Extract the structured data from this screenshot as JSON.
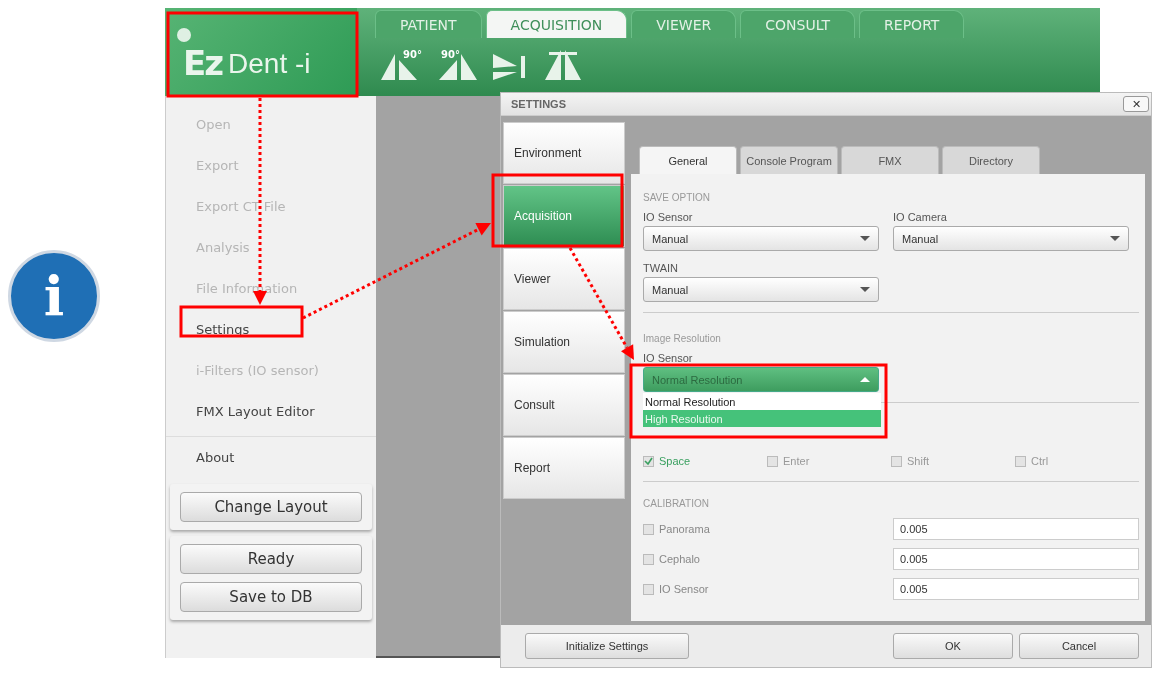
{
  "logo": {
    "mark": "Ez",
    "name": "Dent -i"
  },
  "main_tabs": [
    {
      "label": "PATIENT",
      "selected": false
    },
    {
      "label": "ACQUISITION",
      "selected": true
    },
    {
      "label": "VIEWER",
      "selected": false
    },
    {
      "label": "CONSULT",
      "selected": false
    },
    {
      "label": "REPORT",
      "selected": false
    }
  ],
  "toolbar": [
    {
      "kind": "left-angle",
      "label": "90°"
    },
    {
      "kind": "right-angle",
      "label": "90°"
    },
    {
      "kind": "flip"
    },
    {
      "kind": "split"
    }
  ],
  "menu": [
    {
      "label": "Open",
      "disabled": true
    },
    {
      "label": "Export",
      "disabled": true
    },
    {
      "label": "Export CT File",
      "disabled": true
    },
    {
      "label": "Analysis",
      "disabled": true
    },
    {
      "label": "File Information",
      "disabled": true
    },
    {
      "label": "Settings",
      "disabled": false
    },
    {
      "label": "i-Filters (IO sensor)",
      "disabled": true
    },
    {
      "label": "FMX Layout Editor",
      "disabled": false
    },
    {
      "label": "About",
      "disabled": false
    }
  ],
  "menu_buttons": [
    [
      "Change Layout"
    ],
    [
      "Ready",
      "Save to DB"
    ]
  ],
  "settings": {
    "title": "SETTINGS",
    "close": "✕",
    "categories": [
      {
        "label": "Environment",
        "selected": false
      },
      {
        "label": "Acquisition",
        "selected": true
      },
      {
        "label": "Viewer",
        "selected": false
      },
      {
        "label": "Simulation",
        "selected": false
      },
      {
        "label": "Consult",
        "selected": false
      },
      {
        "label": "Report",
        "selected": false
      }
    ],
    "tabs": [
      {
        "label": "General",
        "selected": true
      },
      {
        "label": "Console Program",
        "selected": false
      },
      {
        "label": "FMX",
        "selected": false
      },
      {
        "label": "Directory",
        "selected": false
      }
    ],
    "save_option": {
      "heading": "SAVE OPTION",
      "io_sensor": {
        "label": "IO Sensor",
        "value": "Manual"
      },
      "io_camera": {
        "label": "IO Camera",
        "value": "Manual"
      },
      "twain": {
        "label": "TWAIN",
        "value": "Manual"
      }
    },
    "image_resolution": {
      "heading": "Image Resolution",
      "label": "IO Sensor",
      "value": "Normal Resolution",
      "expanded": true,
      "options": [
        {
          "label": "Normal Resolution",
          "highlighted": false
        },
        {
          "label": "High Resolution",
          "highlighted": true
        }
      ]
    },
    "capture_keys": [
      {
        "label": "Space",
        "checked": true
      },
      {
        "label": "Enter",
        "checked": false
      },
      {
        "label": "Shift",
        "checked": false
      },
      {
        "label": "Ctrl",
        "checked": false
      }
    ],
    "calibration": {
      "heading": "CALIBRATION",
      "rows": [
        {
          "label": "Panorama",
          "checked": false,
          "value": "0.005"
        },
        {
          "label": "Cephalo",
          "checked": false,
          "value": "0.005"
        },
        {
          "label": "IO Sensor",
          "checked": false,
          "value": "0.005"
        }
      ]
    },
    "buttons": {
      "left": "Initialize Settings",
      "ok": "OK",
      "cancel": "Cancel"
    }
  },
  "info_badge": {
    "symbol": "i"
  }
}
